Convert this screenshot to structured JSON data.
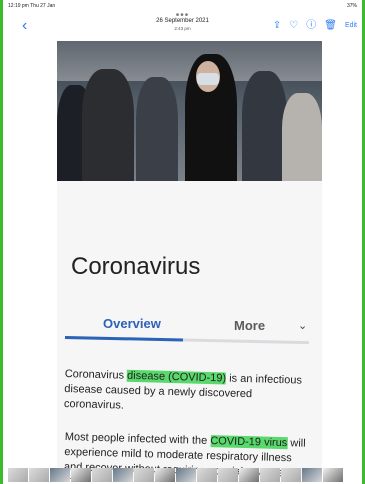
{
  "status": {
    "left": "12:19 pm  Thu 27 Jan",
    "right": "37%"
  },
  "toolbar": {
    "date": "26 September 2021",
    "time": "2:43 pm",
    "edit": "Edit"
  },
  "article": {
    "title": "Coronavirus",
    "tabs": [
      "Overview",
      "More"
    ],
    "p1_before": "Coronavirus ",
    "p1_highlight": "disease (COVID-19)",
    "p1_after": " is an infectious disease caused by a newly discovered coronavirus.",
    "p2_before": "Most people infected with the ",
    "p2_highlight": "COVID-19 virus",
    "p2_after": " will experience mild to moderate respiratory illness and recover without requiring special treatment. Older people, and those with underlying medical"
  },
  "icons": {
    "back": "chevron-left-icon",
    "share": "share-icon",
    "favorite": "heart-icon",
    "info": "info-icon",
    "delete": "trash-icon",
    "menu": "chevron-down-icon"
  }
}
